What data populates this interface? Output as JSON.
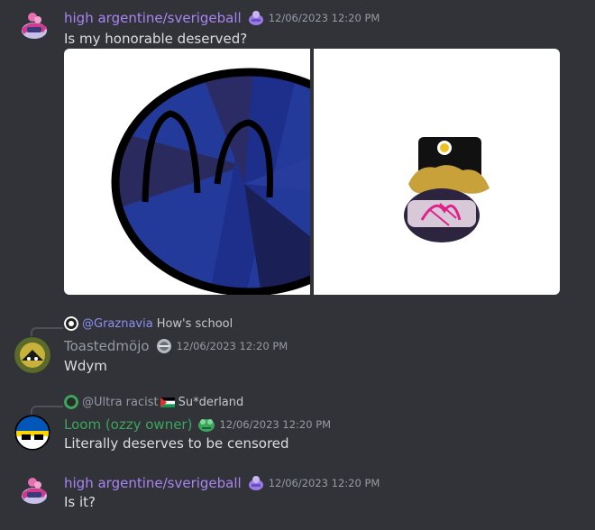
{
  "messages": [
    {
      "username": "high argentine/sverigeball",
      "username_color": "#a884f3",
      "timestamp": "12/06/2023 12:20 PM",
      "content": "Is my honorable deserved?"
    },
    {
      "reply": {
        "mention": "@Graznavia",
        "text": "How's school"
      },
      "username": "Toastedmöjo",
      "username_color": "#949ba4",
      "timestamp": "12/06/2023 12:20 PM",
      "content": "Wdym"
    },
    {
      "reply": {
        "name": "@Ultra racist",
        "text": "Su*derland"
      },
      "username": "Loom (ozzy owner)",
      "username_color": "#3ba55c",
      "timestamp": "12/06/2023 12:20 PM",
      "content": "Literally deserves to be censored"
    },
    {
      "username": "high argentine/sverigeball",
      "username_color": "#a884f3",
      "timestamp": "12/06/2023 12:20 PM",
      "content": "Is it?"
    }
  ]
}
